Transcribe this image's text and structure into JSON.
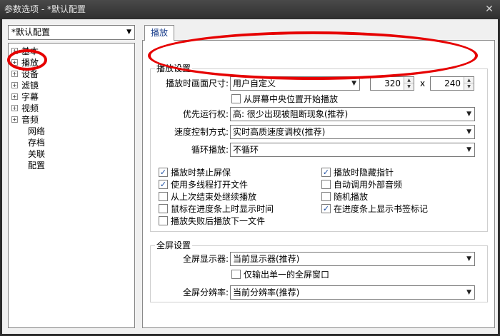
{
  "window": {
    "title": "参数选项 - *默认配置",
    "close_glyph": "✕"
  },
  "profile": {
    "selected": "*默认配置"
  },
  "tree": {
    "items": [
      {
        "label": "基本",
        "expander": "+"
      },
      {
        "label": "播放",
        "expander": "+"
      },
      {
        "label": "设备",
        "expander": "+"
      },
      {
        "label": "滤镜",
        "expander": "+"
      },
      {
        "label": "字幕",
        "expander": "+"
      },
      {
        "label": "视频",
        "expander": "+"
      },
      {
        "label": "音频",
        "expander": "+"
      },
      {
        "label": "网络"
      },
      {
        "label": "存档"
      },
      {
        "label": "关联"
      },
      {
        "label": "配置"
      }
    ]
  },
  "tab": {
    "label": "播放"
  },
  "playback_settings": {
    "title": "播放设置",
    "size_label": "播放时画面尺寸:",
    "size_value": "用户自定义",
    "width": "320",
    "times": "x",
    "height": "240",
    "resume_label": "从屏幕中央位置开始播放",
    "priority_label": "优先运行权:",
    "priority_value": "高: 很少出现被阻断现象(推荐)",
    "speed_label": "速度控制方式:",
    "speed_value": "实时高质速度调校(推荐)",
    "loop_label": "循环播放:",
    "loop_value": "不循环"
  },
  "options": {
    "left": [
      {
        "label": "播放时禁止屏保",
        "checked": true
      },
      {
        "label": "使用多线程打开文件",
        "checked": true
      },
      {
        "label": "从上次结束处继续播放",
        "checked": false
      },
      {
        "label": "鼠标在进度条上时显示时间",
        "checked": false
      },
      {
        "label": "播放失败后播放下一文件",
        "checked": false
      }
    ],
    "right": [
      {
        "label": "播放时隐藏指针",
        "checked": true
      },
      {
        "label": "自动调用外部音频",
        "checked": false
      },
      {
        "label": "随机播放",
        "checked": false
      },
      {
        "label": "在进度条上显示书签标记",
        "checked": true
      }
    ]
  },
  "fullscreen": {
    "title": "全屏设置",
    "display_label": "全屏显示器:",
    "display_value": "当前显示器(推荐)",
    "single_label": "仅输出单一的全屏窗口",
    "resolution_label": "全屏分辨率:",
    "resolution_value": "当前分辨率(推荐)"
  },
  "colors": {
    "annotation": "#e60000",
    "tab_text": "#1a3e8c",
    "check": "#1d4fa3"
  }
}
